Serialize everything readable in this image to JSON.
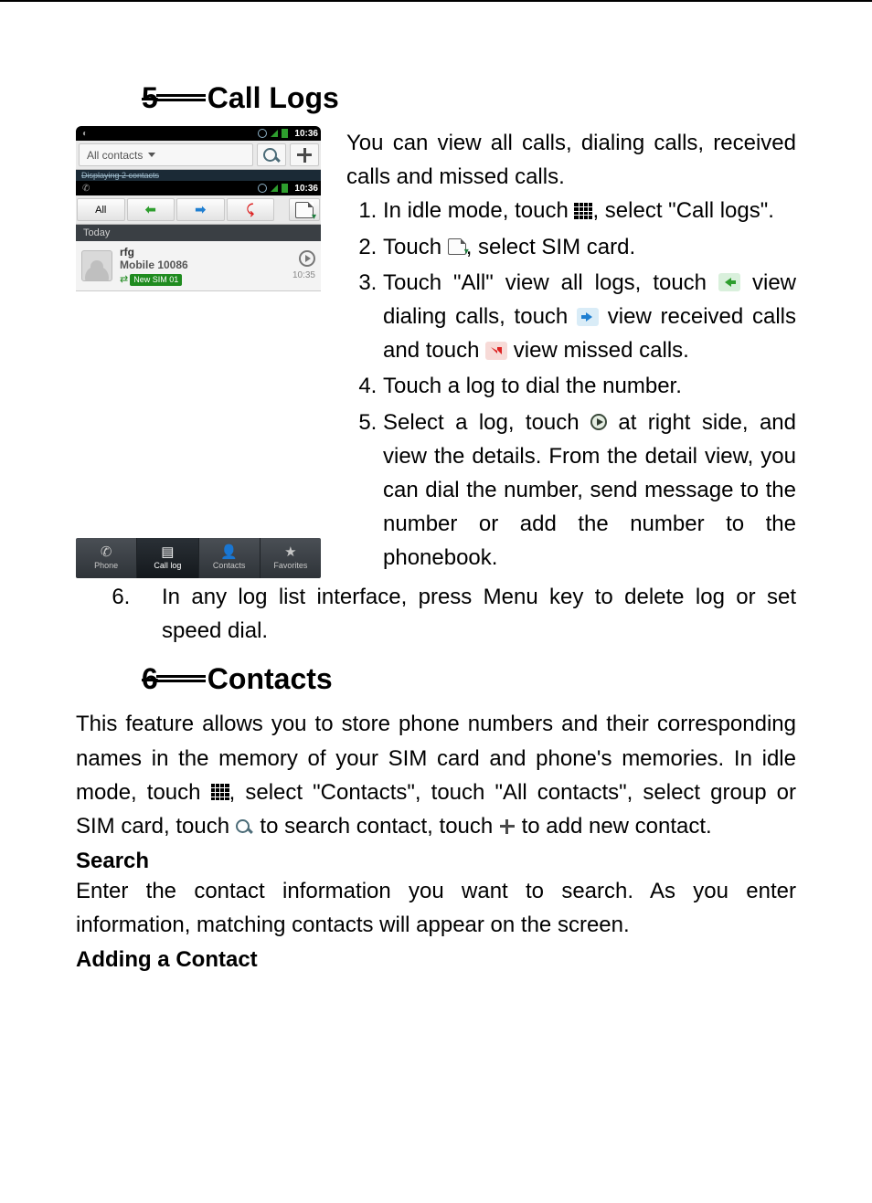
{
  "section5": {
    "number": "5",
    "title": "Call Logs",
    "intro": "You can view all calls, dialing calls, received calls and missed calls.",
    "step1_a": "In idle mode, touch",
    "step1_b": ", select \"Call logs\".",
    "step2_a": "Touch",
    "step2_b": ", select SIM card.",
    "step3_a": "Touch \"All\" view all logs, touch ",
    "step3_b": " view dialing calls, touch ",
    "step3_c": " view received calls and touch ",
    "step3_d": " view missed calls.",
    "step4": "Touch a log to dial the number.",
    "step5_a": "Select a log, touch ",
    "step5_b": " at right side, and view the details. From the detail view, you can dial the number, send message to the number or add the number to the phonebook.",
    "step6": "In any log list interface, press Menu key to delete log or set speed dial."
  },
  "section6": {
    "number": "6",
    "title": "Contacts",
    "para_a": "This feature allows you to store phone numbers and their corresponding names in the memory of your SIM card and phone's memories. In idle mode, touch",
    "para_b": ", select \"Contacts\", touch \"All contacts\", select group or SIM card, touch",
    "para_c": " to search contact, touch",
    "para_d": " to add new contact.",
    "search_head": "Search",
    "search_body": "Enter the contact information you want to search. As you enter information, matching contacts will appear on the screen.",
    "adding_head": "Adding a Contact"
  },
  "screenshot": {
    "statusbar_time_top": "10:36",
    "statusbar_time_mid": "10:36",
    "all_contacts": "All contacts",
    "displaying": "Displaying 2 contacts",
    "tab_all": "All",
    "today": "Today",
    "log_name": "rfg",
    "log_sub": "Mobile 10086",
    "sim_pill": "New SIM 01",
    "log_time": "10:35",
    "nav_phone": "Phone",
    "nav_calllog": "Call log",
    "nav_contacts": "Contacts",
    "nav_fav": "Favorites"
  }
}
